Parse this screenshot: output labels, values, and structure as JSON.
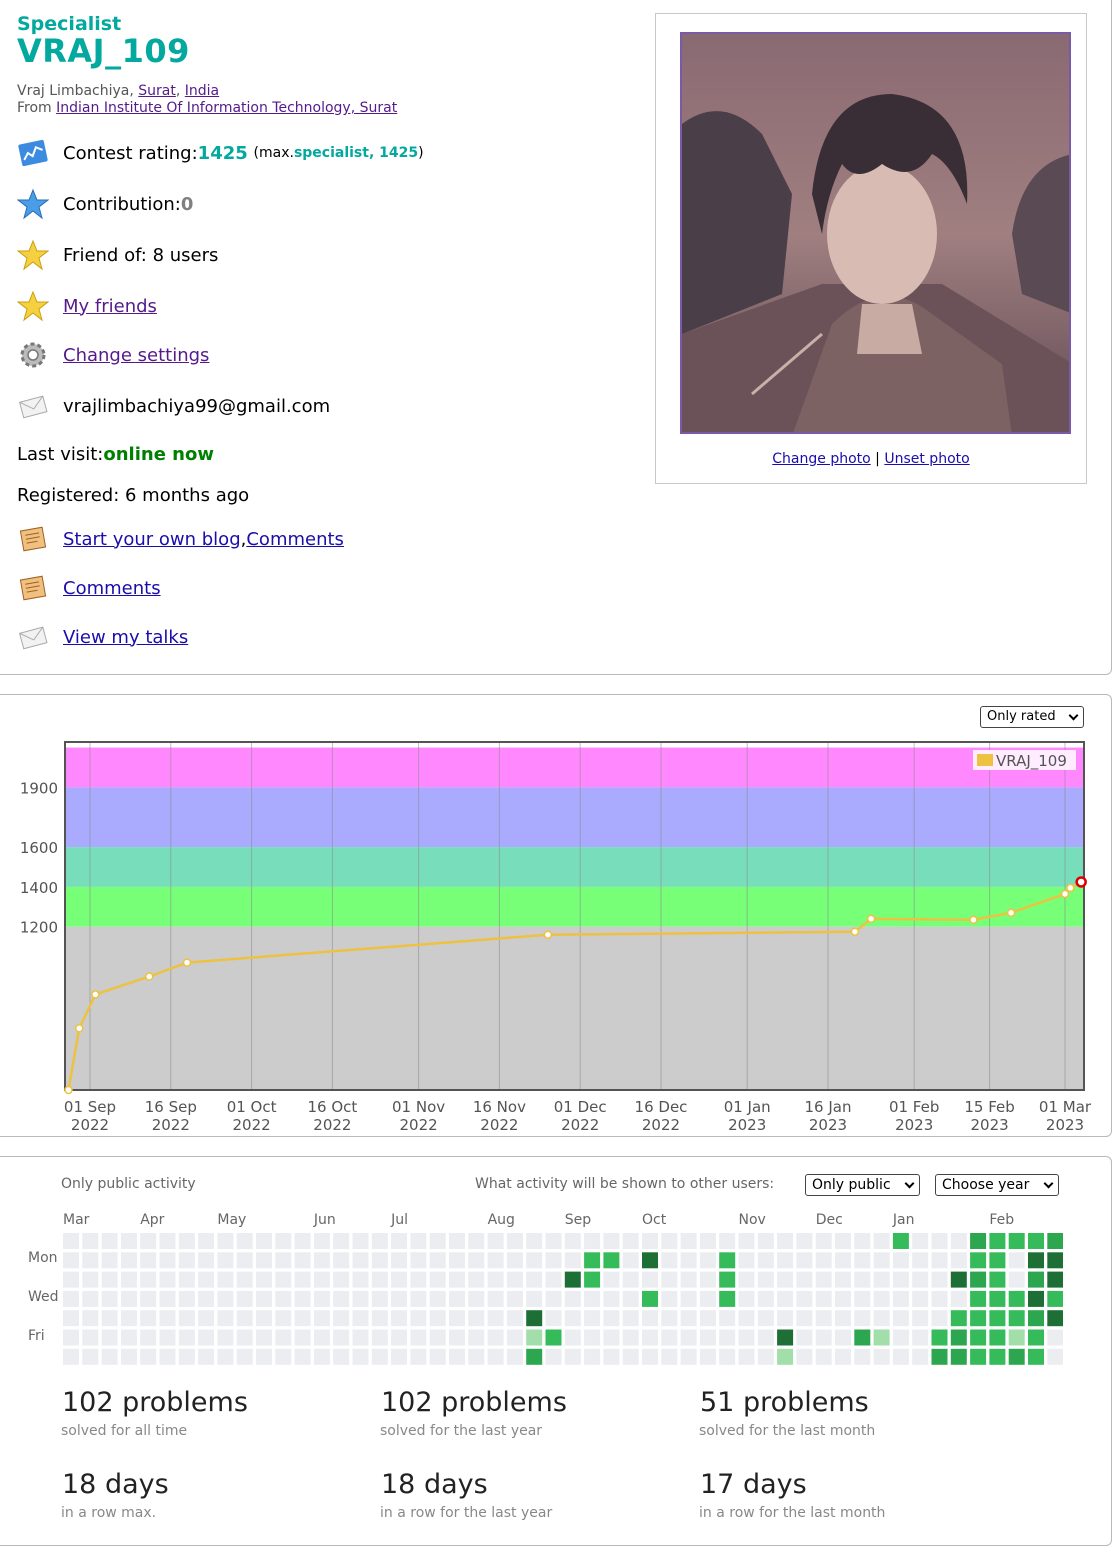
{
  "profile": {
    "rank": "Specialist",
    "handle": "VRAJ_109",
    "name_prefix": "Vraj Limbachiya, ",
    "city": "Surat",
    "comma": ", ",
    "country": "India",
    "from_label": "From ",
    "organization": "Indian Institute Of Information Technology, Surat",
    "contest_rating_label": "Contest rating: ",
    "contest_rating": "1425",
    "max_open": "(max. ",
    "max_rank": "specialist, 1425",
    "max_close": ")",
    "contribution_label": "Contribution: ",
    "contribution": "0",
    "friend_of": "Friend of: 8 users",
    "my_friends": "My friends",
    "change_settings": "Change settings",
    "email": "vrajlimbachiya99@gmail.com",
    "last_visit_label": "Last visit: ",
    "last_visit": "online now",
    "registered": "Registered: 6 months ago",
    "start_blog": "Start your own blog",
    "blog_sep": ", ",
    "comments_inline": "Comments",
    "comments": "Comments",
    "view_talks": "View my talks",
    "change_photo": "Change photo",
    "photo_sep": " | ",
    "unset_photo": "Unset photo"
  },
  "rating_chart": {
    "filter_select": "Only rated",
    "chart_data": {
      "type": "line",
      "title": "",
      "xlabel": "",
      "ylabel": "",
      "legend": "top-right",
      "y_ticks": [
        "1900",
        "1600",
        "1400",
        "1200"
      ],
      "x_ticks": [
        {
          "day": "01 Sep",
          "year": "2022"
        },
        {
          "day": "16 Sep",
          "year": "2022"
        },
        {
          "day": "01 Oct",
          "year": "2022"
        },
        {
          "day": "16 Oct",
          "year": "2022"
        },
        {
          "day": "01 Nov",
          "year": "2022"
        },
        {
          "day": "16 Nov",
          "year": "2022"
        },
        {
          "day": "01 Dec",
          "year": "2022"
        },
        {
          "day": "16 Dec",
          "year": "2022"
        },
        {
          "day": "01 Jan",
          "year": "2023"
        },
        {
          "day": "16 Jan",
          "year": "2023"
        },
        {
          "day": "01 Feb",
          "year": "2023"
        },
        {
          "day": "15 Feb",
          "year": "2023"
        },
        {
          "day": "01 Mar",
          "year": "2023"
        }
      ],
      "bands": [
        {
          "from": 1900,
          "to": 2100,
          "color": "#ff88ff"
        },
        {
          "from": 1600,
          "to": 1900,
          "color": "#aaaaff"
        },
        {
          "from": 1400,
          "to": 1600,
          "color": "#77ddbb"
        },
        {
          "from": 1200,
          "to": 1400,
          "color": "#77ff77"
        },
        {
          "from": 0,
          "to": 1200,
          "color": "#cccccc"
        }
      ],
      "series": [
        {
          "name": "VRAJ_109",
          "color": "#edc240",
          "points": [
            {
              "date": "2022-08-28",
              "rating": 380
            },
            {
              "date": "2022-08-30",
              "rating": 690
            },
            {
              "date": "2022-09-02",
              "rating": 860
            },
            {
              "date": "2022-09-12",
              "rating": 950
            },
            {
              "date": "2022-09-19",
              "rating": 1020
            },
            {
              "date": "2022-11-25",
              "rating": 1160
            },
            {
              "date": "2023-01-21",
              "rating": 1175
            },
            {
              "date": "2023-01-24",
              "rating": 1240
            },
            {
              "date": "2023-02-12",
              "rating": 1235
            },
            {
              "date": "2023-02-19",
              "rating": 1270
            },
            {
              "date": "2023-03-01",
              "rating": 1365
            },
            {
              "date": "2023-03-02",
              "rating": 1395
            },
            {
              "date": "2023-03-04",
              "rating": 1425
            }
          ]
        }
      ]
    }
  },
  "activity": {
    "visibility_note": "Only public activity",
    "shown_label": "What activity will be shown to other users:",
    "visibility_select": "Only public",
    "year_select": "Choose year",
    "months": [
      {
        "label": "Mar",
        "week": 0
      },
      {
        "label": "Apr",
        "week": 4
      },
      {
        "label": "May",
        "week": 8
      },
      {
        "label": "Jun",
        "week": 13
      },
      {
        "label": "Jul",
        "week": 17
      },
      {
        "label": "Aug",
        "week": 22
      },
      {
        "label": "Sep",
        "week": 26
      },
      {
        "label": "Oct",
        "week": 30
      },
      {
        "label": "Nov",
        "week": 35
      },
      {
        "label": "Dec",
        "week": 39
      },
      {
        "label": "Jan",
        "week": 43
      },
      {
        "label": "Feb",
        "week": 48
      }
    ],
    "days": [
      {
        "label": "Mon",
        "row": 1
      },
      {
        "label": "Wed",
        "row": 3
      },
      {
        "label": "Fri",
        "row": 5
      }
    ],
    "weeks": 53,
    "level_colors": [
      "#ebedf0",
      "#a1dea9",
      "#36bb5a",
      "#2ca64f",
      "#1d6f36"
    ],
    "active_cells": [
      {
        "week": 43,
        "day": 0,
        "level": 2
      },
      {
        "week": 27,
        "day": 1,
        "level": 2
      },
      {
        "week": 28,
        "day": 1,
        "level": 2
      },
      {
        "week": 30,
        "day": 1,
        "level": 4
      },
      {
        "week": 34,
        "day": 1,
        "level": 2
      },
      {
        "week": 26,
        "day": 2,
        "level": 4
      },
      {
        "week": 27,
        "day": 2,
        "level": 2
      },
      {
        "week": 34,
        "day": 2,
        "level": 2
      },
      {
        "week": 30,
        "day": 3,
        "level": 2
      },
      {
        "week": 34,
        "day": 3,
        "level": 2
      },
      {
        "week": 24,
        "day": 4,
        "level": 4
      },
      {
        "week": 24,
        "day": 5,
        "level": 1
      },
      {
        "week": 25,
        "day": 5,
        "level": 2
      },
      {
        "week": 37,
        "day": 5,
        "level": 4
      },
      {
        "week": 41,
        "day": 5,
        "level": 3
      },
      {
        "week": 42,
        "day": 5,
        "level": 1
      },
      {
        "week": 24,
        "day": 6,
        "level": 3
      },
      {
        "week": 37,
        "day": 6,
        "level": 1
      },
      {
        "week": 47,
        "day": 0,
        "level": 3
      },
      {
        "week": 48,
        "day": 0,
        "level": 2
      },
      {
        "week": 49,
        "day": 0,
        "level": 2
      },
      {
        "week": 50,
        "day": 0,
        "level": 2
      },
      {
        "week": 51,
        "day": 0,
        "level": 3
      },
      {
        "week": 47,
        "day": 1,
        "level": 2
      },
      {
        "week": 48,
        "day": 1,
        "level": 2
      },
      {
        "week": 50,
        "day": 1,
        "level": 4
      },
      {
        "week": 51,
        "day": 1,
        "level": 4
      },
      {
        "week": 46,
        "day": 2,
        "level": 4
      },
      {
        "week": 47,
        "day": 2,
        "level": 3
      },
      {
        "week": 48,
        "day": 2,
        "level": 2
      },
      {
        "week": 50,
        "day": 2,
        "level": 3
      },
      {
        "week": 51,
        "day": 2,
        "level": 4
      },
      {
        "week": 47,
        "day": 3,
        "level": 2
      },
      {
        "week": 48,
        "day": 3,
        "level": 2
      },
      {
        "week": 49,
        "day": 3,
        "level": 2
      },
      {
        "week": 50,
        "day": 3,
        "level": 4
      },
      {
        "week": 51,
        "day": 3,
        "level": 2
      },
      {
        "week": 46,
        "day": 4,
        "level": 2
      },
      {
        "week": 47,
        "day": 4,
        "level": 2
      },
      {
        "week": 48,
        "day": 4,
        "level": 2
      },
      {
        "week": 49,
        "day": 4,
        "level": 2
      },
      {
        "week": 50,
        "day": 4,
        "level": 3
      },
      {
        "week": 51,
        "day": 4,
        "level": 4
      },
      {
        "week": 45,
        "day": 5,
        "level": 2
      },
      {
        "week": 46,
        "day": 5,
        "level": 3
      },
      {
        "week": 47,
        "day": 5,
        "level": 2
      },
      {
        "week": 48,
        "day": 5,
        "level": 2
      },
      {
        "week": 49,
        "day": 5,
        "level": 1
      },
      {
        "week": 50,
        "day": 5,
        "level": 2
      },
      {
        "week": 45,
        "day": 6,
        "level": 3
      },
      {
        "week": 46,
        "day": 6,
        "level": 3
      },
      {
        "week": 47,
        "day": 6,
        "level": 2
      },
      {
        "week": 48,
        "day": 6,
        "level": 2
      },
      {
        "week": 49,
        "day": 6,
        "level": 3
      },
      {
        "week": 50,
        "day": 6,
        "level": 2
      }
    ],
    "stats": [
      {
        "value": "102 problems",
        "label": "solved for all time"
      },
      {
        "value": "102 problems",
        "label": "solved for the last year"
      },
      {
        "value": "51 problems",
        "label": "solved for the last month"
      },
      {
        "value": "18 days",
        "label": "in a row max."
      },
      {
        "value": "18 days",
        "label": "in a row for the last year"
      },
      {
        "value": "17 days",
        "label": "in a row for the last month"
      }
    ]
  }
}
